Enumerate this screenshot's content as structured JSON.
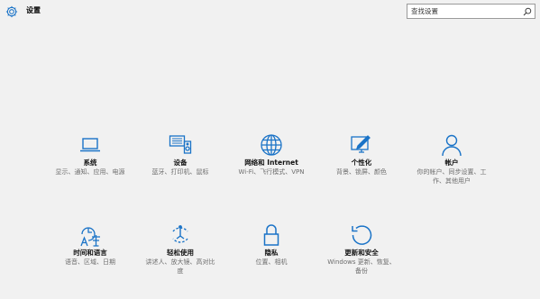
{
  "app": {
    "title": "设置",
    "search_placeholder": "查找设置",
    "accent_color": "#1a73c7"
  },
  "tiles": [
    {
      "icon": "laptop-icon",
      "label": "系统",
      "desc": "显示、通知、应用、电源"
    },
    {
      "icon": "devices-icon",
      "label": "设备",
      "desc": "蓝牙、打印机、鼠标"
    },
    {
      "icon": "globe-icon",
      "label": "网络和 Internet",
      "desc": "Wi-Fi、飞行模式、VPN"
    },
    {
      "icon": "personalize-icon",
      "label": "个性化",
      "desc": "背景、锁屏、颜色"
    },
    {
      "icon": "person-icon",
      "label": "帐户",
      "desc": "你的帐户、同步设置、工作、其他用户"
    },
    {
      "icon": "time-language-icon",
      "label": "时间和语言",
      "desc": "语音、区域、日期"
    },
    {
      "icon": "ease-of-access-icon",
      "label": "轻松使用",
      "desc": "讲述人、放大镜、高对比度"
    },
    {
      "icon": "lock-icon",
      "label": "隐私",
      "desc": "位置、相机"
    },
    {
      "icon": "update-icon",
      "label": "更新和安全",
      "desc": "Windows 更新、恢复、备份"
    }
  ]
}
